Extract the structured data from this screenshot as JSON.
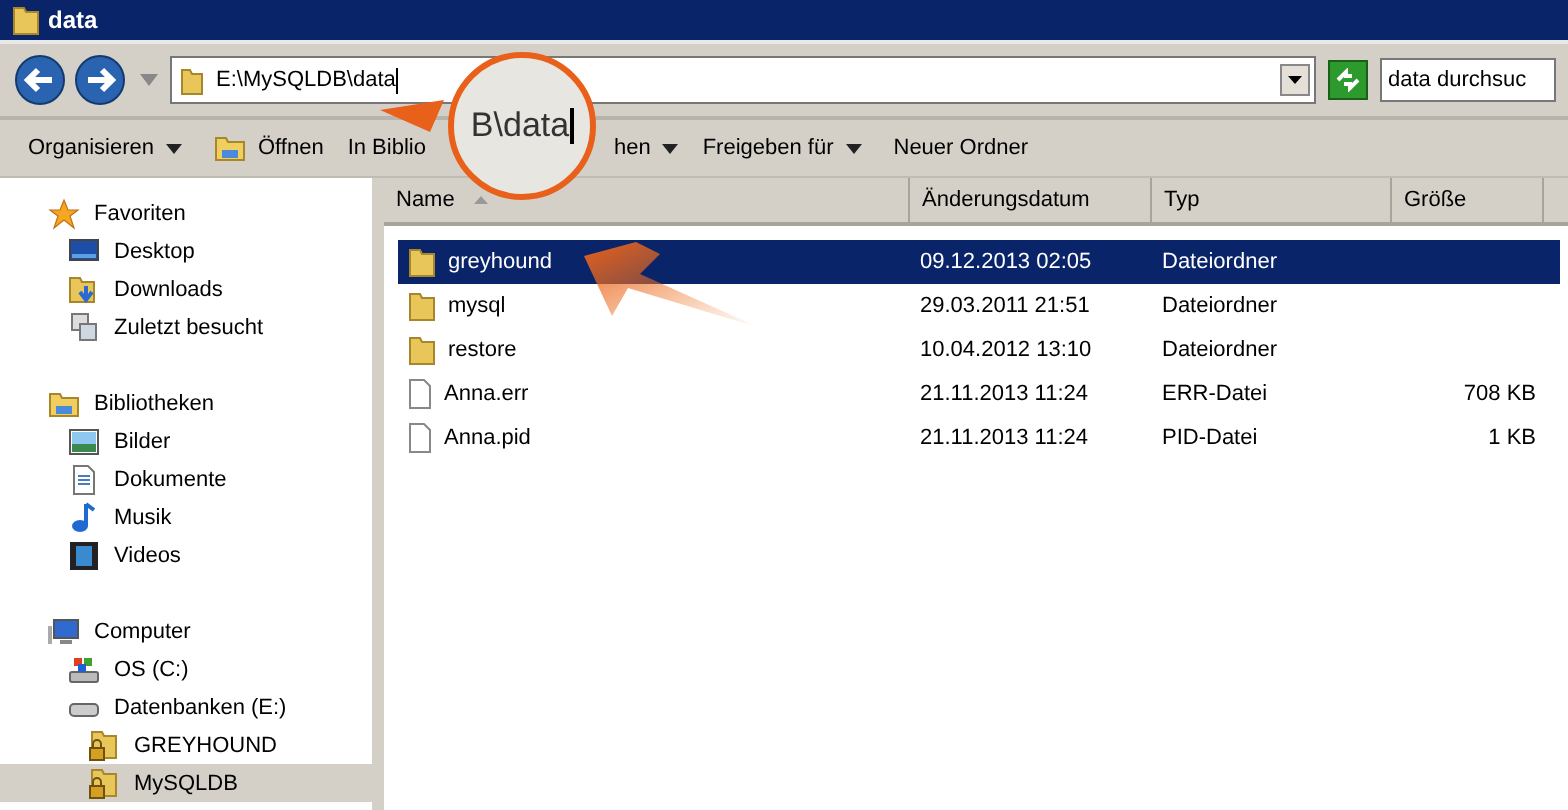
{
  "window": {
    "title": "data"
  },
  "address": {
    "path": "E:\\MySQLDB\\data",
    "search_placeholder": "data durchsuc"
  },
  "magnifier": {
    "text": "B\\data"
  },
  "toolbar": [
    {
      "label": "Organisieren",
      "kind": "menu"
    },
    {
      "label": "Öffnen",
      "kind": "open"
    },
    {
      "label": "In Biblio",
      "label_end": "hen",
      "kind": "split-menu"
    },
    {
      "label": "Freigeben für",
      "kind": "menu"
    },
    {
      "label": "Neuer Ordner",
      "kind": "plain"
    }
  ],
  "sidebar": {
    "groups": [
      {
        "label": "Favoriten",
        "kind": "star",
        "children": [
          {
            "label": "Desktop",
            "kind": "desktop",
            "selected": false
          },
          {
            "label": "Downloads",
            "kind": "download",
            "selected": false
          },
          {
            "label": "Zuletzt besucht",
            "kind": "recent",
            "selected": false
          }
        ]
      },
      {
        "label": "Bibliotheken",
        "kind": "library",
        "children": [
          {
            "label": "Bilder",
            "kind": "pictures",
            "selected": false
          },
          {
            "label": "Dokumente",
            "kind": "document",
            "selected": false
          },
          {
            "label": "Musik",
            "kind": "music",
            "selected": false
          },
          {
            "label": "Videos",
            "kind": "video",
            "selected": false
          }
        ]
      },
      {
        "label": "Computer",
        "kind": "computer",
        "children": [
          {
            "label": "OS (C:)",
            "kind": "os-drive",
            "selected": false
          },
          {
            "label": "Datenbanken (E:)",
            "kind": "drive",
            "selected": false,
            "children": [
              {
                "label": "GREYHOUND",
                "kind": "locked-folder",
                "selected": false
              },
              {
                "label": "MySQLDB",
                "kind": "locked-folder",
                "selected": true
              }
            ]
          }
        ]
      }
    ]
  },
  "table": {
    "columns": [
      {
        "label": "Name",
        "sorted": true
      },
      {
        "label": "Änderungsdatum",
        "sorted": false
      },
      {
        "label": "Typ",
        "sorted": false
      },
      {
        "label": "Größe",
        "sorted": false
      }
    ],
    "rows": [
      {
        "name": "greyhound",
        "date": "09.12.2013 02:05",
        "type": "Dateiordner",
        "kind": "folder",
        "selected": true
      },
      {
        "name": "mysql",
        "date": "29.03.2011 21:51",
        "type": "Dateiordner",
        "kind": "folder",
        "selected": false
      },
      {
        "name": "restore",
        "date": "10.04.2012 13:10",
        "type": "Dateiordner",
        "kind": "folder",
        "selected": false
      },
      {
        "name": "Anna.err",
        "date": "21.11.2013 11:24",
        "type": "ERR-Datei",
        "size": "708 KB",
        "kind": "file",
        "selected": false
      },
      {
        "name": "Anna.pid",
        "date": "21.11.2013 11:24",
        "type": "PID-Datei",
        "size": "1 KB",
        "kind": "file",
        "selected": false
      }
    ]
  }
}
